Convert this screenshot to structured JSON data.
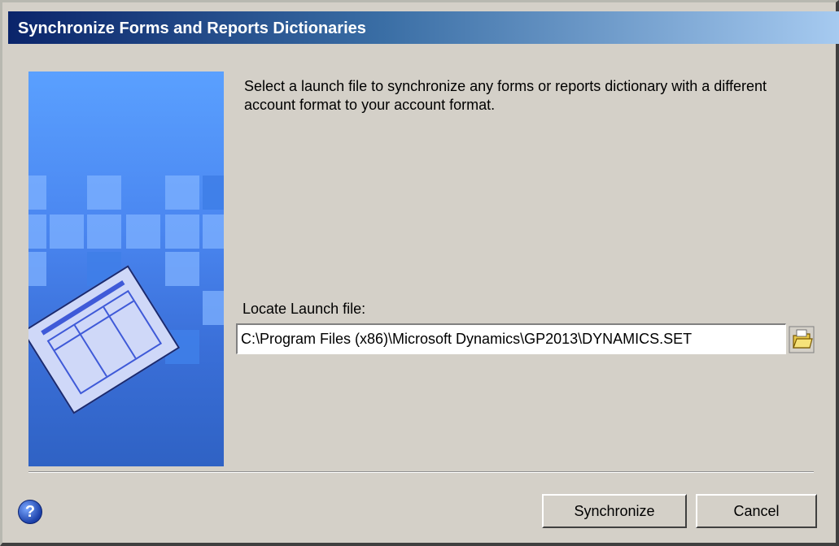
{
  "window": {
    "title": "Synchronize Forms and Reports Dictionaries"
  },
  "main": {
    "description": "Select a launch file to synchronize any forms or reports dictionary with a different account format to your account format.",
    "locate_label": "Locate Launch file:",
    "launch_file_path": "C:\\Program Files (x86)\\Microsoft Dynamics\\GP2013\\DYNAMICS.SET"
  },
  "icons": {
    "browse": "folder-open-icon",
    "help": "help-icon",
    "art": "dictionary-document-illustration"
  },
  "footer": {
    "help_glyph": "?",
    "synchronize_label": "Synchronize",
    "cancel_label": "Cancel"
  },
  "colors": {
    "title_start": "#0a246a",
    "title_end": "#a6caf0",
    "dialog_bg": "#d4d0c8",
    "art_blue": "#4a86f0"
  }
}
